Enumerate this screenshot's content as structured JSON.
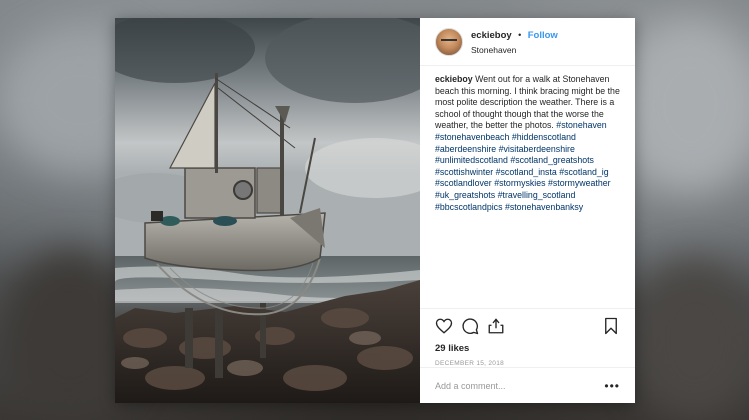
{
  "post": {
    "author": {
      "username": "eckieboy",
      "follow_label": "Follow",
      "separator": "•",
      "location": "Stonehaven",
      "avatar_icon": "avatar-photo"
    },
    "caption": {
      "username": "eckieboy",
      "text": "Went out for a walk at Stonehaven beach this morning. I think bracing might be the most polite description the weather. There is a school of thought though that the worse the weather, the better the photos.",
      "hashtags": [
        "#stonehaven",
        "#stonehavenbeach",
        "#hiddenscotland",
        "#aberdeenshire",
        "#visitaberdeenshire",
        "#unlimitedscotland",
        "#scotland_greatshots",
        "#scottishwinter",
        "#scotland_insta",
        "#scotland_ig",
        "#scotlandlover",
        "#stormyskies",
        "#stormyweather",
        "#uk_greatshots",
        "#travelling_scotland",
        "#bbcscotlandpics",
        "#stonehavenbanksy"
      ]
    },
    "actions": {
      "icons": [
        "heart-icon",
        "comment-icon",
        "share-icon",
        "bookmark-icon"
      ]
    },
    "likes": "29 likes",
    "date": "DECEMBER 15, 2018",
    "comment": {
      "placeholder": "Add a comment...",
      "more_label": "•••"
    }
  },
  "colors": {
    "link": "#003569",
    "follow": "#3897f0",
    "text": "#262626",
    "muted": "#999999",
    "border": "#efefef"
  }
}
